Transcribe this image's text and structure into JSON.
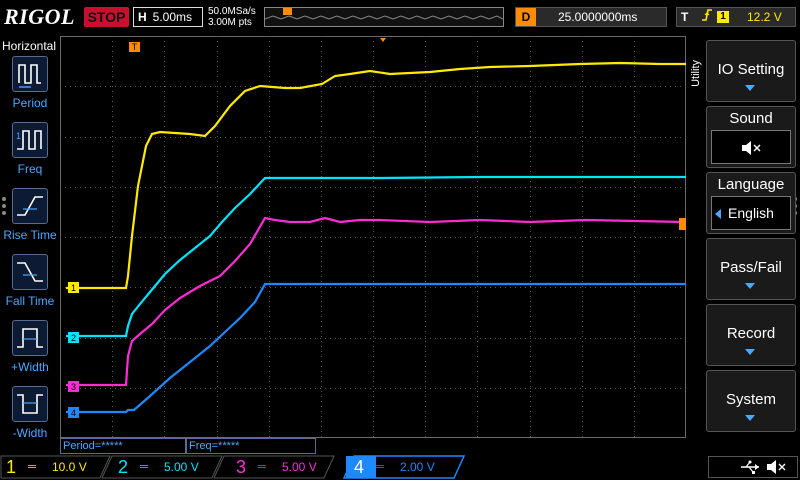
{
  "topbar": {
    "logo": "RIGOL",
    "run_state": "STOP",
    "timebase_label": "H",
    "timebase_value": "5.00ms",
    "sample_rate": "50.0MSa/s",
    "memory_depth": "3.00M pts",
    "delay_label": "D",
    "delay_value": "25.0000000ms",
    "trigger_label": "T",
    "trigger_source": "1",
    "trigger_level": "12.2 V",
    "trigger_edge_icon": "rising-edge-icon"
  },
  "left_panel": {
    "title": "Horizontal",
    "items": [
      {
        "label": "Period",
        "icon": "period-icon"
      },
      {
        "label": "Freq",
        "icon": "freq-icon"
      },
      {
        "label": "Rise Time",
        "icon": "rise-time-icon"
      },
      {
        "label": "Fall Time",
        "icon": "fall-time-icon"
      },
      {
        "label": "+Width",
        "icon": "pos-width-icon"
      },
      {
        "label": "-Width",
        "icon": "neg-width-icon"
      }
    ]
  },
  "measurements": {
    "period": "Period=*****",
    "freq": "Freq=*****"
  },
  "channel_markers": [
    "1",
    "2",
    "3",
    "4"
  ],
  "trigger_marker": "T",
  "right_panel": {
    "utility_label": "Utility",
    "io_setting": "IO Setting",
    "sound_label": "Sound",
    "sound_icon": "speaker-mute-icon",
    "language_label": "Language",
    "language_value": "English",
    "pass_fail": "Pass/Fail",
    "record": "Record",
    "system": "System"
  },
  "channels": [
    {
      "num": "1",
      "coupling": "═",
      "scale": "10.0 V",
      "color": "#ffea00"
    },
    {
      "num": "2",
      "coupling": "═",
      "scale": "5.00 V",
      "color": "#00e5ff"
    },
    {
      "num": "3",
      "coupling": "═",
      "scale": "5.00 V",
      "color": "#ff2bd6"
    },
    {
      "num": "4",
      "coupling": "═",
      "scale": "2.00 V",
      "color": "#1e88ff"
    }
  ],
  "status_icons": {
    "usb": "usb-icon",
    "sound": "speaker-mute-icon"
  },
  "colors": {
    "ch1": "#ffea00",
    "ch2": "#00e5ff",
    "ch3": "#ff2bd6",
    "ch4": "#1e88ff",
    "trigger": "#ff8c00",
    "stop": "#c8102e",
    "accent": "#4aa8ff"
  }
}
